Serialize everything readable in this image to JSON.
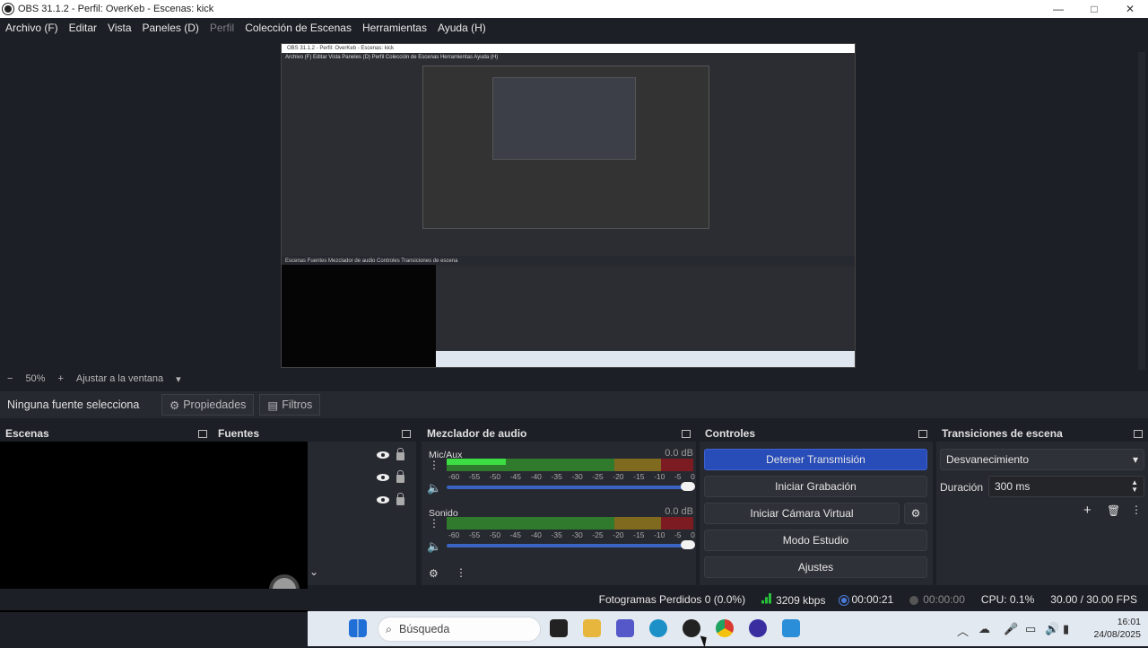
{
  "window": {
    "title": "OBS 31.1.2 - Perfil: OverKeb - Escenas: kick",
    "min": "—",
    "max": "□",
    "close": "✕"
  },
  "menu": [
    "Archivo (F)",
    "Editar",
    "Vista",
    "Paneles (D)",
    "Perfil",
    "Colección de Escenas",
    "Herramientas",
    "Ayuda (H)"
  ],
  "preview": {
    "mini_title": "OBS 31.1.2 - Perfil: OverKeb - Escenas: kick",
    "mini_menu": "Archivo (F)   Editar   Vista   Paneles (D)   Perfil   Colección de Escenas   Herramientas   Ayuda (H)",
    "mini_dock": "Escenas          Fuentes          Mezclador de audio          Controles          Transiciones de escena"
  },
  "zoom": {
    "minus": "−",
    "value": "50%",
    "plus": "+",
    "fit": "Ajustar a la ventana",
    "arrow": "▾"
  },
  "source_bar": {
    "no_source": "Ninguna fuente selecciona",
    "props": "Propiedades",
    "filters": "Filtros"
  },
  "docks": {
    "scenes": "Escenas",
    "sources": "Fuentes",
    "mixer": "Mezclador de audio",
    "controls": "Controles",
    "transitions": "Transiciones de escena"
  },
  "mixer": {
    "channels": [
      {
        "name": "Mic/Aux",
        "db": "0.0 dB",
        "level": 0.24
      },
      {
        "name": "Sonido",
        "db": "0.0 dB",
        "level": 0.0
      }
    ],
    "ticks": [
      "-60",
      "-55",
      "-50",
      "-45",
      "-40",
      "-35",
      "-30",
      "-25",
      "-20",
      "-15",
      "-10",
      "-5",
      "0"
    ]
  },
  "controls": {
    "stop_stream": "Detener Transmisión",
    "start_record": "Iniciar Grabación",
    "virtual_cam": "Iniciar Cámara Virtual",
    "studio": "Modo Estudio",
    "settings": "Ajustes"
  },
  "transitions": {
    "selected": "Desvanecimiento",
    "duration_label": "Duración",
    "duration_value": "300 ms"
  },
  "status": {
    "dropped": "Fotogramas Perdidos 0 (0.0%)",
    "kbps": "3209 kbps",
    "stream_time": "00:00:21",
    "rec_time": "00:00:00",
    "cpu": "CPU: 0.1%",
    "fps": "30.00 / 30.00 FPS"
  },
  "taskbar": {
    "search": "Búsqueda",
    "time": "16:01",
    "date": "24/08/2025"
  },
  "colors": {
    "accent": "#284cb8",
    "bg": "#1d1f26",
    "panel": "#272930"
  }
}
